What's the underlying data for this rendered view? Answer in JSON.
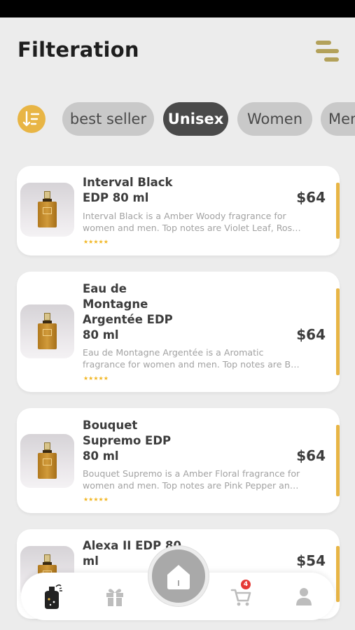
{
  "header": {
    "title": "Filteration"
  },
  "filters": {
    "chips": [
      {
        "label": "best seller",
        "active": false
      },
      {
        "label": "Unisex",
        "active": true
      },
      {
        "label": "Women",
        "active": false
      },
      {
        "label": "Men",
        "active": false
      }
    ]
  },
  "products": [
    {
      "name": "Interval Black EDP 80 ml",
      "name_lines": [
        "Interval Black",
        "EDP 80 ml"
      ],
      "price": "$64",
      "description_lines": [
        "Interval Black is a Amber Woody fragrance for",
        "women and men. Top notes are Violet Leaf, Ros…"
      ],
      "rating": 5,
      "stars": "★★★★★"
    },
    {
      "name": "Eau de Montagne Argentée EDP 80 ml",
      "name_lines": [
        "Eau de",
        "Montagne",
        "Argentée EDP",
        "80 ml"
      ],
      "price": "$64",
      "description_lines": [
        "Eau de Montagne Argentée is a Aromatic",
        "fragrance for women and men. Top notes are B…"
      ],
      "rating": 5,
      "stars": "★★★★★"
    },
    {
      "name": "Bouquet Supremo EDP 80 ml",
      "name_lines": [
        "Bouquet",
        "Supremo EDP",
        "80 ml"
      ],
      "price": "$64",
      "description_lines": [
        "Bouquet Supremo is a Amber Floral fragrance for",
        "women and men. Top notes are Pink Pepper an…"
      ],
      "rating": 5,
      "stars": "★★★★★"
    },
    {
      "name": "Alexa II EDP 80 ml",
      "name_lines": [
        "Alexa II EDP 80",
        "ml"
      ],
      "price": "$54"
    }
  ],
  "bottom_nav": {
    "items": [
      "perfume-icon",
      "gift-icon",
      "home-icon",
      "cart-icon",
      "profile-icon"
    ],
    "cart_count": "4"
  },
  "colors": {
    "accent": "#e8b545",
    "active_chip": "#4a4a4a",
    "chip": "#c9c9c9",
    "menu": "#b3a15a",
    "badge": "#e53935"
  }
}
